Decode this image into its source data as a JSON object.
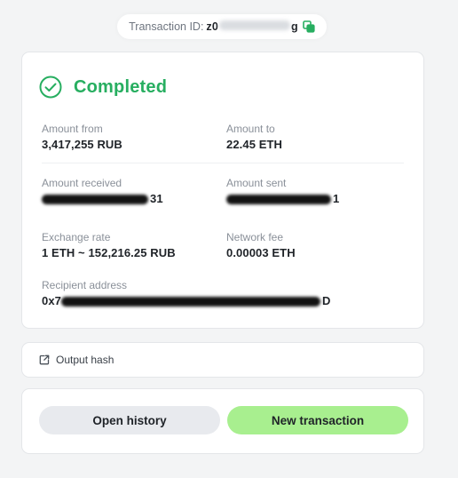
{
  "transaction": {
    "id_label": "Transaction ID:",
    "id_visible": "z0",
    "id_suffix": "g"
  },
  "status": {
    "label": "Completed",
    "color": "#27ae60"
  },
  "details": {
    "amount_from": {
      "label": "Amount from",
      "value": "3,417,255 RUB"
    },
    "amount_to": {
      "label": "Amount to",
      "value": "22.45 ETH"
    },
    "amount_received": {
      "label": "Amount received",
      "value_tail": "31"
    },
    "amount_sent": {
      "label": "Amount sent",
      "value_tail": "1"
    },
    "exchange_rate": {
      "label": "Exchange rate",
      "value": "1 ETH ~ 152,216.25 RUB"
    },
    "network_fee": {
      "label": "Network fee",
      "value": "0.00003 ETH"
    },
    "recipient": {
      "label": "Recipient address",
      "value_prefix": "0x7",
      "value_suffix": "D"
    }
  },
  "output_hash": {
    "label": "Output hash"
  },
  "actions": {
    "open_history": "Open history",
    "new_transaction": "New transaction"
  },
  "colors": {
    "accent_green": "#27ae60",
    "new_button_bg": "#a8ef8f",
    "history_button_bg": "#e8eaee"
  },
  "icons": {
    "status": "check-circle-icon",
    "copy": "copy-icon",
    "hash": "external-link-icon"
  }
}
